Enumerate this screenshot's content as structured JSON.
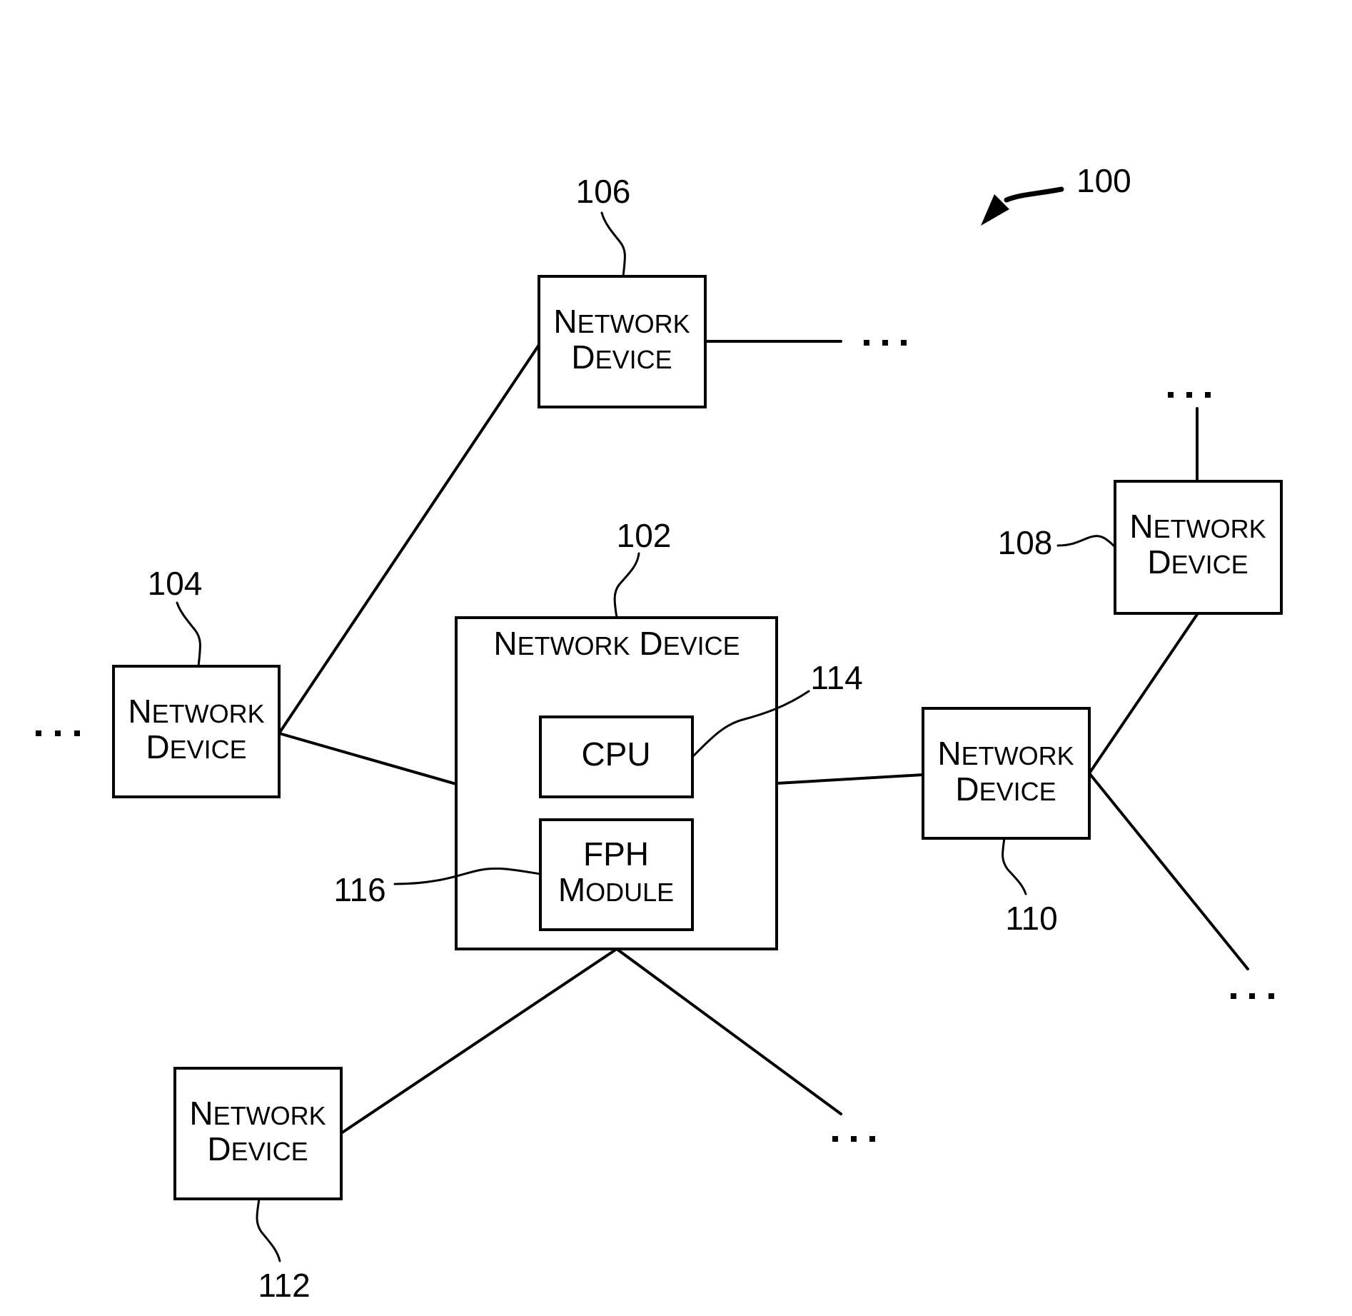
{
  "figure": {
    "reference": "100",
    "colors": {
      "ink": "#000000",
      "background": "#ffffff"
    }
  },
  "devices": [
    {
      "id": "102",
      "line1": "Network Device",
      "line2": ""
    },
    {
      "id": "104",
      "line1": "Network",
      "line2": "Device"
    },
    {
      "id": "106",
      "line1": "Network",
      "line2": "Device"
    },
    {
      "id": "108",
      "line1": "Network",
      "line2": "Device"
    },
    {
      "id": "110",
      "line1": "Network",
      "line2": "Device"
    },
    {
      "id": "112",
      "line1": "Network",
      "line2": "Device"
    }
  ],
  "components": [
    {
      "id": "114",
      "line1": "CPU",
      "line2": ""
    },
    {
      "id": "116",
      "line1": "FPH",
      "line2": "Module"
    }
  ],
  "labels": {
    "n100": "100",
    "n102": "102",
    "n104": "104",
    "n106": "106",
    "n108": "108",
    "n110": "110",
    "n112": "112",
    "n114": "114",
    "n116": "116",
    "network_word": "N",
    "network_rest": "ETWORK",
    "device_word": "D",
    "device_rest": "EVICE",
    "module_word": "M",
    "module_rest": "ODULE",
    "cpu": "CPU",
    "fph": "FPH"
  },
  "continuation_marker": "..."
}
